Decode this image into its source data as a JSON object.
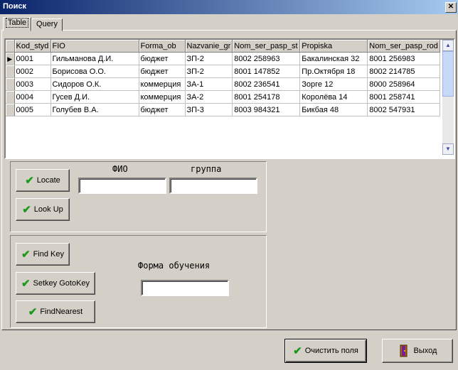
{
  "window": {
    "title": "Поиск",
    "close_glyph": "✕"
  },
  "tabs": [
    {
      "label": "Table",
      "active": true
    },
    {
      "label": "Query",
      "active": false
    }
  ],
  "grid": {
    "columns": [
      "Kod_styd",
      "FIO",
      "Forma_ob",
      "Nazvanie_gr",
      "Nom_ser_pasp_st",
      "Propiska",
      "Nom_ser_pasp_rod"
    ],
    "rows": [
      [
        "0001",
        "Гильманова Д.И.",
        "бюджет",
        "ЗП-2",
        "8002 258963",
        "Бакалинская 32",
        "8001 256983"
      ],
      [
        "0002",
        "Борисова О.О.",
        "бюджет",
        "ЗП-2",
        "8001 147852",
        "Пр.Октября 18",
        "8002 214785"
      ],
      [
        "0003",
        "Сидоров О.К.",
        "коммерция",
        "ЗА-1",
        "8002 236541",
        "Зорге 12",
        "8000 258964"
      ],
      [
        "0004",
        "Гусев Д.И.",
        "коммерция",
        "ЗА-2",
        "8001 254178",
        "Королёва 14",
        "8001 258741"
      ],
      [
        "0005",
        "Голубев В.А.",
        "бюджет",
        "ЗП-3",
        "8003 984321",
        "Бикбая 48",
        "8002 547931"
      ]
    ],
    "current_row_glyph": "▶",
    "scroll_up_glyph": "▲",
    "scroll_down_glyph": "▼"
  },
  "locate_panel": {
    "fio_label": "ФИО",
    "group_label": "группа",
    "fio_value": "",
    "group_value": "",
    "locate_label": "Locate",
    "lookup_label": "Look Up"
  },
  "key_panel": {
    "findkey_label": "Find Key",
    "setkey_label": "Setkey GotoKey",
    "findnearest_label": "FindNearest",
    "forma_label": "Форма обучения",
    "forma_value": ""
  },
  "footer": {
    "clear_label": "Очистить поля",
    "exit_label": "Выход"
  },
  "icons": {
    "check": "✔",
    "exit": "exit-door-icon"
  },
  "colors": {
    "check_green": "#1a9a1a",
    "title_start": "#0a246a",
    "title_end": "#a6caf0"
  }
}
